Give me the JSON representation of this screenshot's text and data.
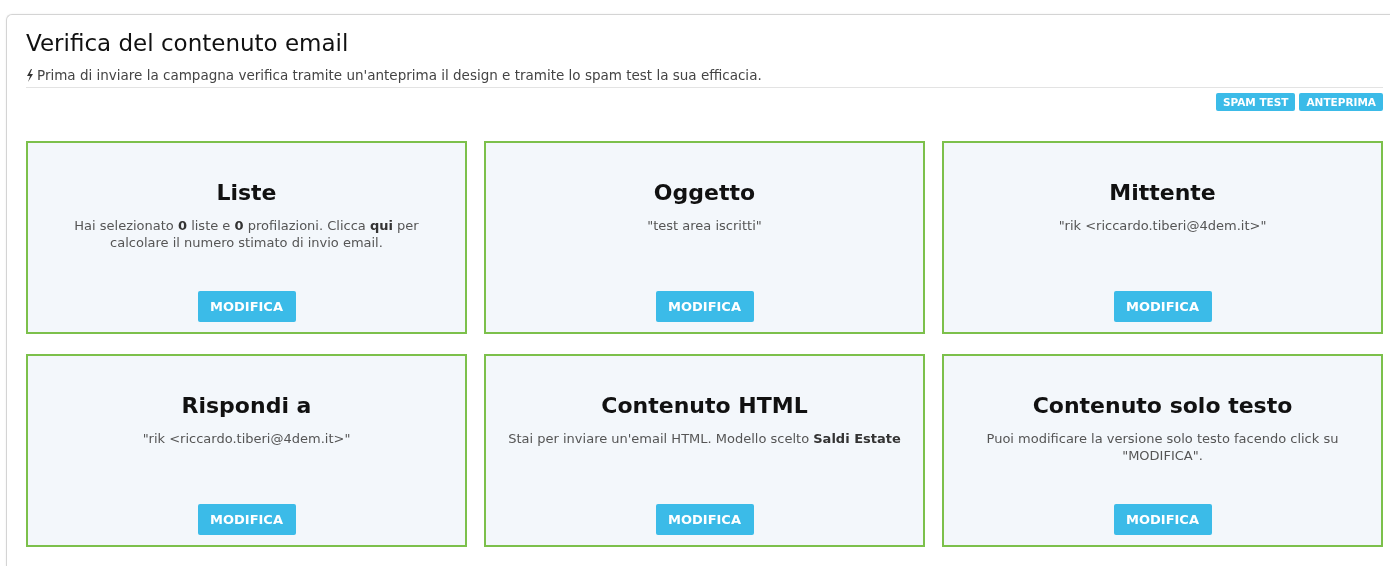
{
  "header": {
    "title": "Verifica del contenuto email",
    "subtitle": "Prima di inviare la campagna verifica tramite un'anteprima il design e tramite lo spam test la sua efficacia."
  },
  "actions": [
    "SPAM TEST",
    "ANTEPRIMA"
  ],
  "cards": [
    {
      "title": "Liste",
      "text": "Hai selezionato **0** liste e **0** profilazioni. Clicca **qui** per calcolare il numero stimato di invio email.",
      "button": "MODIFICA"
    },
    {
      "title": "Oggetto",
      "text": "\"test area iscritti\"",
      "button": "MODIFICA"
    },
    {
      "title": "Mittente",
      "text": "\"rik <riccardo.tiberi@4dem.it>\"",
      "button": "MODIFICA"
    },
    {
      "title": "Rispondi a",
      "text": "\"rik <riccardo.tiberi@4dem.it>\"",
      "button": "MODIFICA"
    },
    {
      "title": "Contenuto HTML",
      "text": "Stai per inviare un'email HTML. Modello scelto **Saldi Estate**",
      "button": "MODIFICA"
    },
    {
      "title": "Contenuto solo testo",
      "text": "Puoi modificare la versione solo testo facendo click su \"MODIFICA\".",
      "button": "MODIFICA"
    }
  ]
}
